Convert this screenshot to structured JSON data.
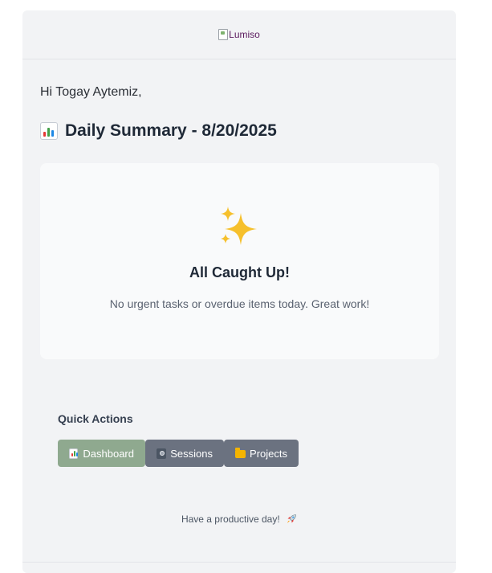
{
  "header": {
    "logo_alt": "Lumiso"
  },
  "greeting": "Hi Togay Aytemiz,",
  "summary": {
    "title": "Daily Summary - 8/20/2025",
    "title_icon": "bar-chart-emoji",
    "status_icon": "sparkles-emoji",
    "status_title": "All Caught Up!",
    "status_text": "No urgent tasks or overdue items today. Great work!"
  },
  "quick_actions": {
    "label": "Quick Actions",
    "buttons": [
      {
        "label": "Dashboard",
        "icon": "bar-chart-emoji",
        "color": "#8fa98f"
      },
      {
        "label": "Sessions",
        "icon": "camera-flash-emoji",
        "color": "#6b7280"
      },
      {
        "label": "Projects",
        "icon": "folder-emoji",
        "color": "#6b7280"
      }
    ]
  },
  "closing": {
    "text": "Have a productive day!",
    "icon": "rocket-emoji"
  },
  "colors": {
    "card_bg": "#f2f3f5",
    "summary_bg": "#f9fafb",
    "heading": "#1f2937",
    "accent_green": "#8fa98f",
    "button_gray": "#6b7280"
  }
}
